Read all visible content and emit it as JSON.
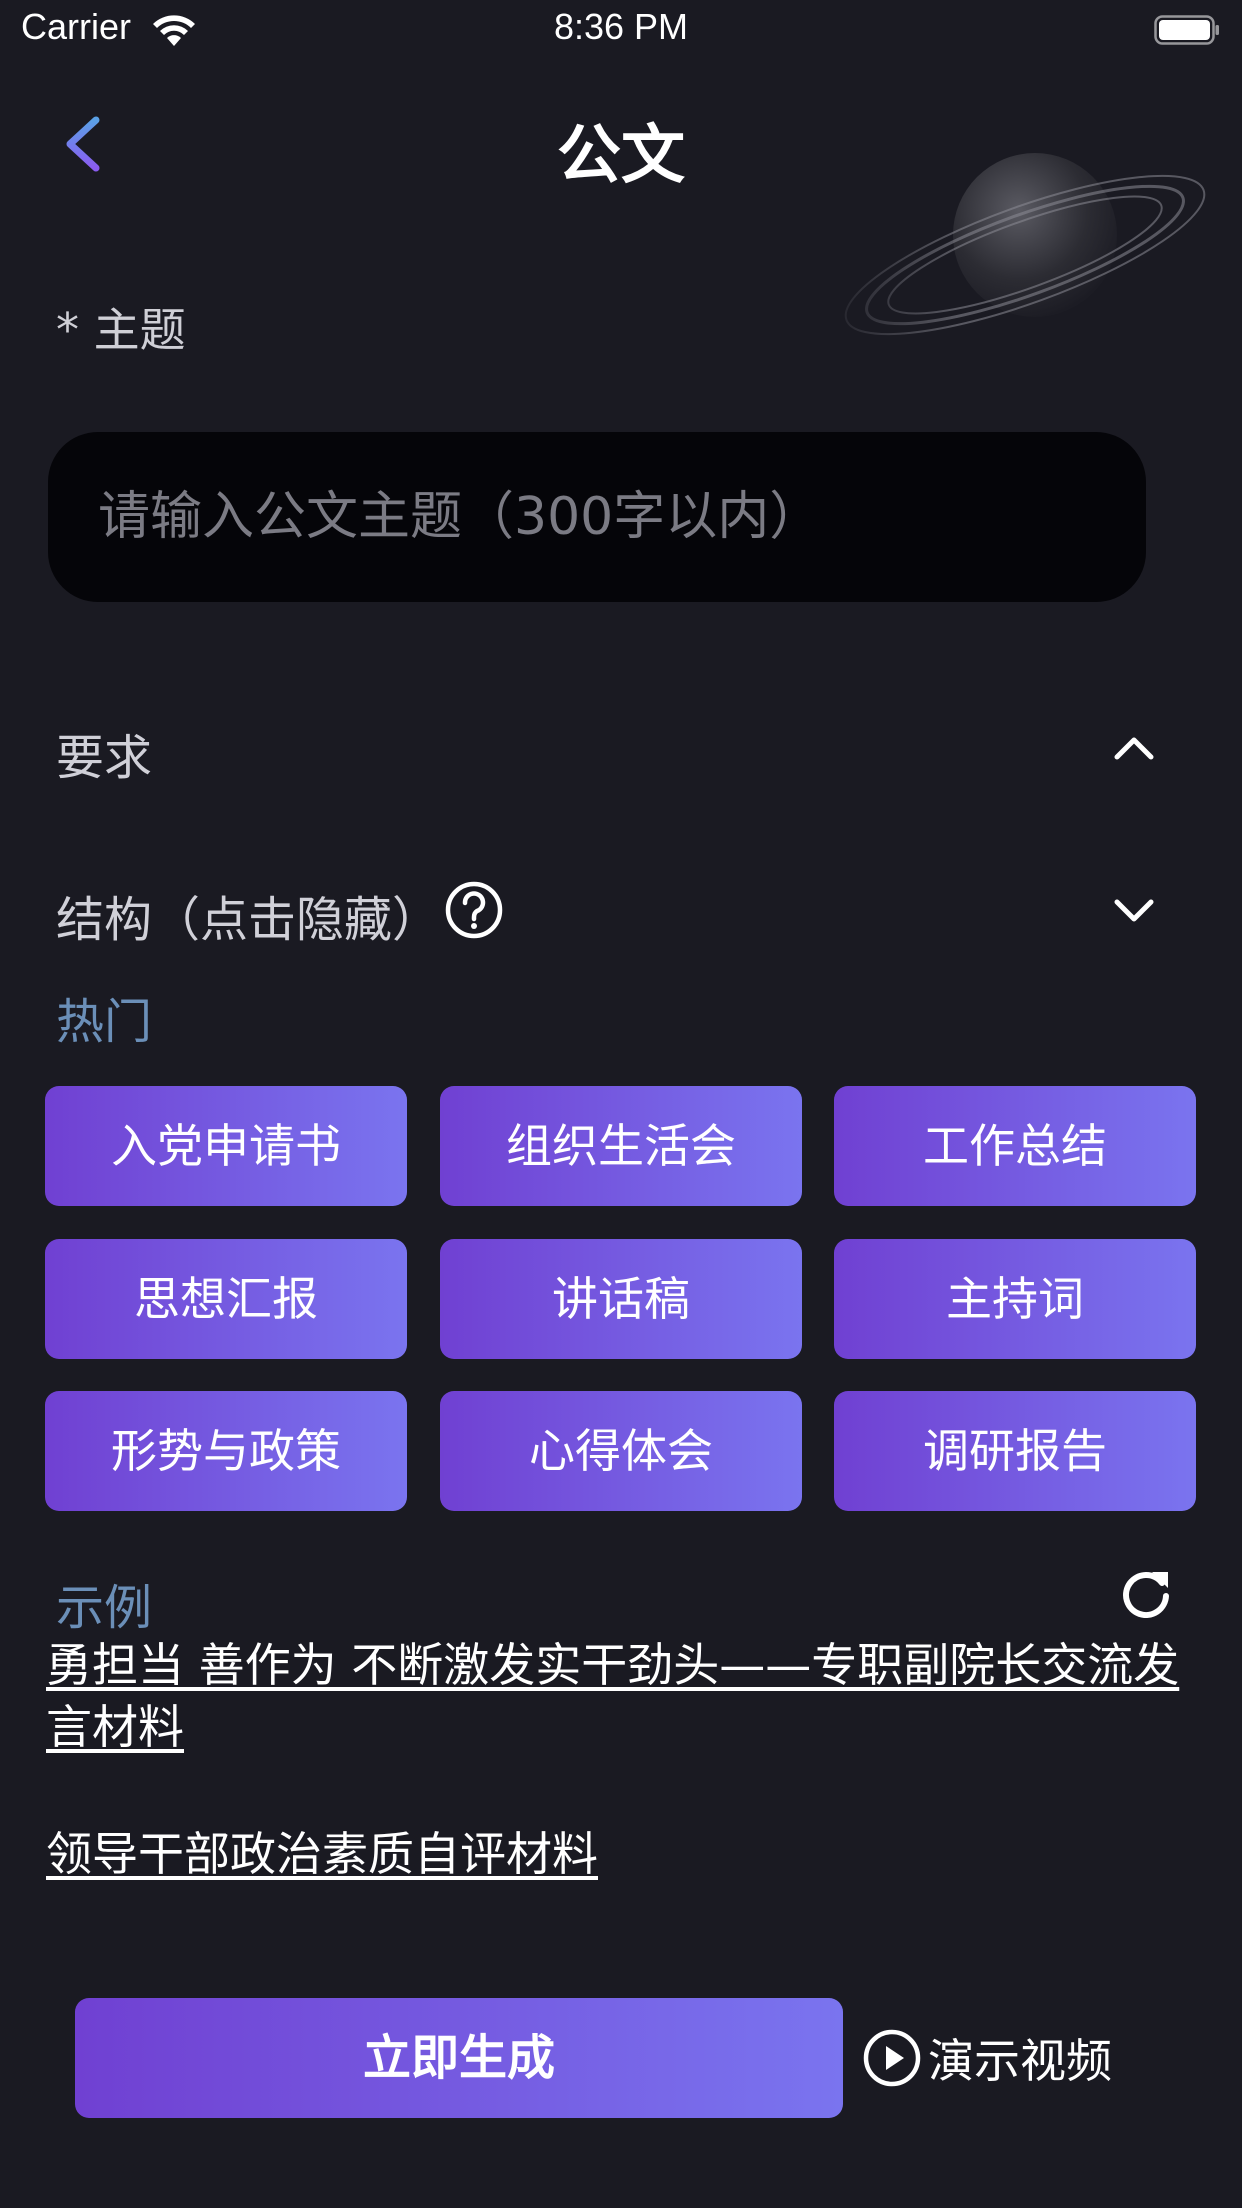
{
  "status_bar": {
    "carrier": "Carrier",
    "time": "8:36 PM",
    "icons": [
      "wifi-icon",
      "battery-icon"
    ]
  },
  "header": {
    "title": "公文",
    "back_icon": "chevron-left-icon",
    "accent_gradient": [
      "#5aa0e6",
      "#8a5cf0"
    ]
  },
  "subject": {
    "label": "* 主题",
    "value": "",
    "placeholder": "请输入公文主题（300字以内）"
  },
  "requirements": {
    "label": "要求",
    "toggle_icon": "chevron-up-icon"
  },
  "structure": {
    "label": "结构（点击隐藏）",
    "help_icon": "question-circle-icon",
    "toggle_icon": "chevron-down-icon"
  },
  "hot": {
    "label": "热门",
    "tags": [
      "入党申请书",
      "组织生活会",
      "工作总结",
      "思想汇报",
      "讲话稿",
      "主持词",
      "形势与政策",
      "心得体会",
      "调研报告"
    ]
  },
  "examples": {
    "label": "示例",
    "refresh_icon": "refresh-icon",
    "items": [
      "勇担当 善作为 不断激发实干劲头——专职副院长交流发言材料",
      "领导干部政治素质自评材料"
    ]
  },
  "actions": {
    "generate_label": "立即生成",
    "demo_label": "演示视频",
    "demo_icon": "play-circle-icon"
  },
  "colors": {
    "background": "#1a1a22",
    "input_bg": "#050509",
    "button_gradient_start": "#7040d2",
    "button_gradient_end": "#7a74ef",
    "section_label": "#6b8fb8"
  }
}
